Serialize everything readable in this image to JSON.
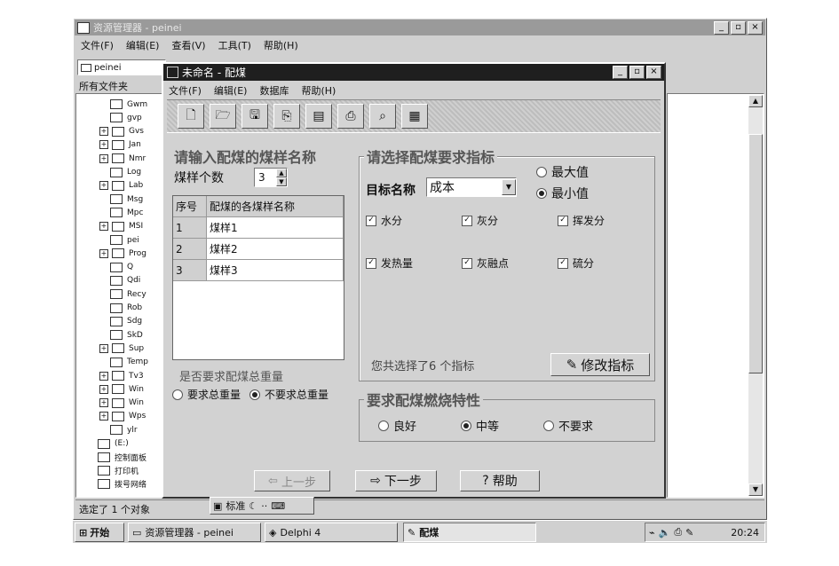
{
  "explorer": {
    "title": "资源管理器 - peinei",
    "menu": [
      "文件(F)",
      "编辑(E)",
      "查看(V)",
      "工具(T)",
      "帮助(H)"
    ],
    "address": "peinei",
    "folders_header": "所有文件夹",
    "tree_items": [
      "Gwm",
      "gvp",
      "Gvs",
      "Jan",
      "Nmr",
      "Log",
      "Lab",
      "Msg",
      "Mpc",
      "MSI",
      "pei",
      "Prog",
      "Q",
      "Qdi",
      "Recy",
      "Rob",
      "Sdg",
      "SkD",
      "Sup",
      "Temp",
      "Tv3",
      "Win",
      "Win",
      "Wps",
      "ylr",
      "(E:)",
      "控制面板",
      "打印机",
      "拨号网络"
    ],
    "status": "选定了 1 个对象"
  },
  "dialog": {
    "title": "未命名 - 配煤",
    "menu": [
      "文件(F)",
      "编辑(E)",
      "数据库",
      "帮助(H)"
    ],
    "toolbar_icons": [
      "new-file-icon",
      "open-file-icon",
      "save-icon",
      "copy-icon",
      "database-icon",
      "print-icon",
      "preview-icon",
      "calculator-icon"
    ],
    "left_heading": "请输入配煤的煤样名称",
    "count_label": "煤样个数",
    "count_value": "3",
    "table_headers": [
      "序号",
      "配煤的各煤样名称"
    ],
    "table_rows": [
      {
        "no": "1",
        "name": "煤样1"
      },
      {
        "no": "2",
        "name": "煤样2"
      },
      {
        "no": "3",
        "name": "煤样3"
      }
    ],
    "weight_question": "是否要求配煤总重量",
    "weight_options": [
      "要求总重量",
      "不要求总重量"
    ],
    "weight_selected": 1,
    "right_heading": "请选择配煤要求指标",
    "target_label": "目标名称",
    "target_value": "成本",
    "extreme_options": [
      "最大值",
      "最小值"
    ],
    "extreme_selected": 1,
    "indicators": [
      "水分",
      "灰分",
      "挥发分",
      "发热量",
      "灰融点",
      "硫分"
    ],
    "selected_summary": "您共选择了6 个指标",
    "modify_button": "修改指标",
    "combustion_heading": "要求配煤燃烧特性",
    "combustion_options": [
      "良好",
      "中等",
      "不要求"
    ],
    "combustion_selected": 1,
    "prev_button": "上一步",
    "next_button": "下一步",
    "help_button": "帮助"
  },
  "ime": {
    "label": "标准"
  },
  "taskbar": {
    "start": "开始",
    "tasks": [
      "资源管理器 - peinei",
      "Delphi 4",
      "配煤"
    ],
    "clock": "20:24"
  },
  "colors": {
    "titlebar": "#1f1f1f",
    "face": "#d4d4d4",
    "desktop": "#ffffff"
  }
}
